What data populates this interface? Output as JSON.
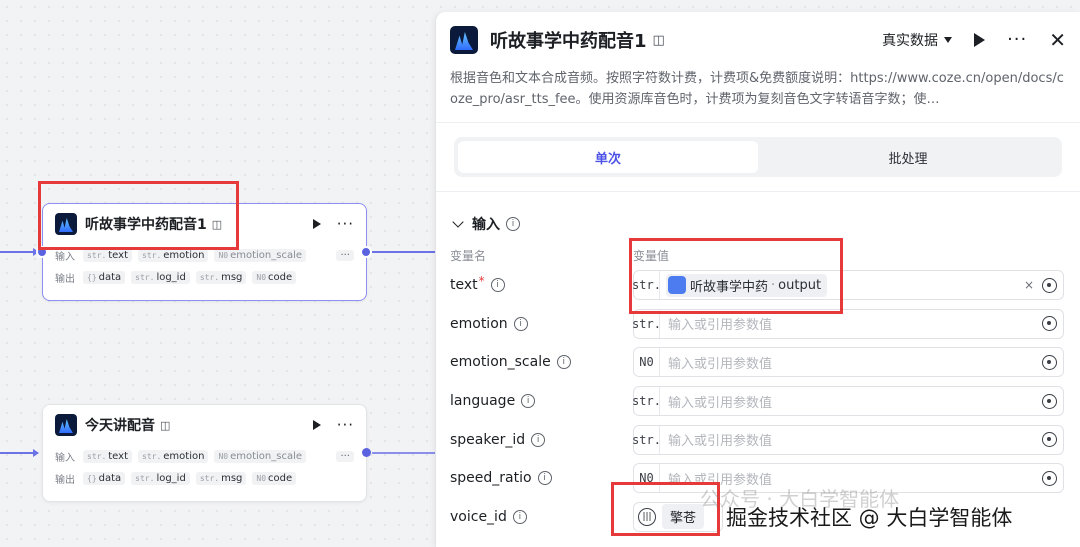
{
  "nodes": [
    {
      "title": "听故事学中药配音1",
      "sub_icon": "ribbon-icon",
      "inputs_label": "输入",
      "outputs_label": "输出",
      "inputs": [
        {
          "type": "str.",
          "name": "text"
        },
        {
          "type": "str.",
          "name": "emotion"
        },
        {
          "type": "N0",
          "name": "emotion_scale"
        }
      ],
      "outputs": [
        {
          "type": "{}",
          "name": "data"
        },
        {
          "type": "str.",
          "name": "log_id"
        },
        {
          "type": "str.",
          "name": "msg"
        },
        {
          "type": "N0",
          "name": "code"
        }
      ],
      "more": "···"
    },
    {
      "title": "今天讲配音",
      "sub_icon": "ribbon-icon",
      "inputs_label": "输入",
      "outputs_label": "输出",
      "inputs": [
        {
          "type": "str.",
          "name": "text"
        },
        {
          "type": "str.",
          "name": "emotion"
        },
        {
          "type": "N0",
          "name": "emotion_scale"
        }
      ],
      "outputs": [
        {
          "type": "{}",
          "name": "data"
        },
        {
          "type": "str.",
          "name": "log_id"
        },
        {
          "type": "str.",
          "name": "msg"
        },
        {
          "type": "N0",
          "name": "code"
        }
      ],
      "more": "···"
    }
  ],
  "panel": {
    "title": "听故事学中药配音1",
    "data_mode": "真实数据",
    "description": "根据音色和文本合成音频。按照字符数计费，计费项&免费额度说明：https://www.coze.cn/open/docs/coze_pro/asr_tts_fee。使用资源库音色时，计费项为复刻音色文字转语音字数；使…",
    "tabs": [
      "单次",
      "批处理"
    ],
    "active_tab": 0,
    "input_section": "输入",
    "col_name": "变量名",
    "col_value": "变量值",
    "params": [
      {
        "name": "text",
        "required": true,
        "type": "str.",
        "ref": {
          "node": "听故事学中药",
          "sep": "·",
          "field": "output"
        }
      },
      {
        "name": "emotion",
        "required": false,
        "type": "str.",
        "placeholder": "输入或引用参数值"
      },
      {
        "name": "emotion_scale",
        "required": false,
        "type": "N0",
        "placeholder": "输入或引用参数值"
      },
      {
        "name": "language",
        "required": false,
        "type": "str.",
        "placeholder": "输入或引用参数值"
      },
      {
        "name": "speaker_id",
        "required": false,
        "type": "str.",
        "placeholder": "输入或引用参数值"
      },
      {
        "name": "speed_ratio",
        "required": false,
        "type": "N0",
        "placeholder": "输入或引用参数值"
      },
      {
        "name": "voice_id",
        "required": false,
        "voice": "擎苍"
      }
    ],
    "clear_symbol": "×",
    "required_mark": "*",
    "info_symbol": "i"
  },
  "watermark": {
    "faint": "公众号 · 大白学智能体",
    "main": "掘金技术社区 @ 大白学智能体"
  },
  "colors": {
    "accent": "#4d53e8",
    "edge": "#6b73e6",
    "highlight_box": "#e6393a"
  }
}
